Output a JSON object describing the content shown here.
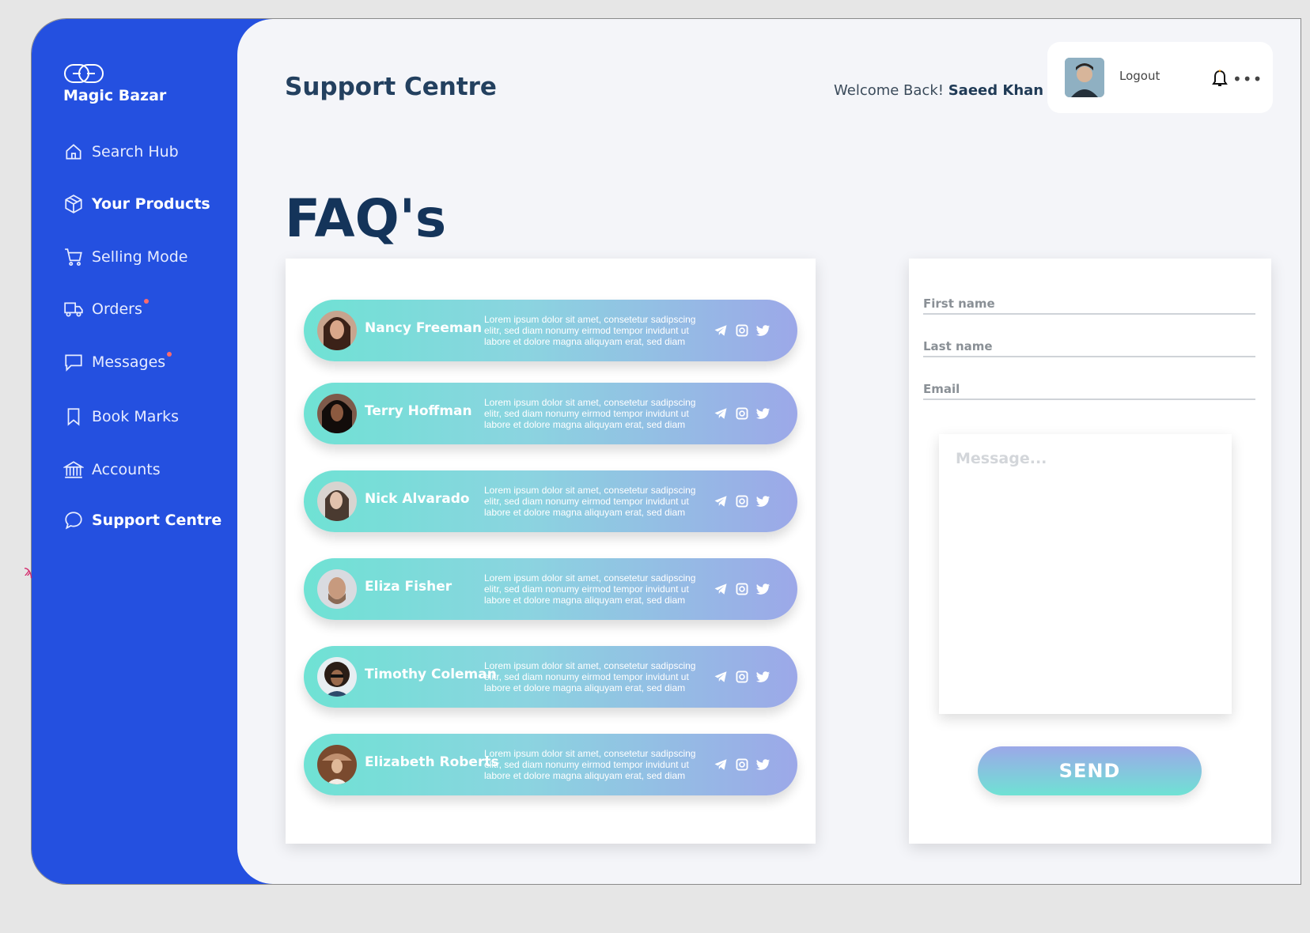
{
  "app": {
    "brand": "Magic Bazar",
    "page_title": "Support Centre",
    "welcome_prefix": "Welcome Back!",
    "user_name": "Saeed Khan",
    "logout_label": "Logout",
    "more_label": "•••"
  },
  "sidebar": {
    "items": [
      {
        "label": "Search Hub",
        "icon": "home-icon",
        "bold": false
      },
      {
        "label": "Your Products",
        "icon": "box-icon",
        "bold": true
      },
      {
        "label": "Selling Mode",
        "icon": "cart-icon",
        "bold": false
      },
      {
        "label": "Orders",
        "icon": "truck-icon",
        "bold": false,
        "badge": true
      },
      {
        "label": "Messages",
        "icon": "chat-icon",
        "bold": false,
        "badge": true
      },
      {
        "label": "Book Marks",
        "icon": "bookmark-icon",
        "bold": false
      },
      {
        "label": "Accounts",
        "icon": "bank-icon",
        "bold": false
      },
      {
        "label": "Support Centre",
        "icon": "speech-bubble-icon",
        "bold": true
      }
    ]
  },
  "faq": {
    "heading": "FAQ's",
    "entries": [
      {
        "name": "Nancy Freeman",
        "text": "Lorem ipsum dolor sit amet, consetetur sadipscing elitr, sed diam nonumy eirmod tempor invidunt ut labore et dolore magna aliquyam erat, sed diam"
      },
      {
        "name": "Terry Hoffman",
        "text": "Lorem ipsum dolor sit amet, consetetur sadipscing elitr, sed diam nonumy eirmod tempor invidunt ut labore et dolore magna aliquyam erat, sed diam"
      },
      {
        "name": "Nick Alvarado",
        "text": "Lorem ipsum dolor sit amet, consetetur sadipscing elitr, sed diam nonumy eirmod tempor invidunt ut labore et dolore magna aliquyam erat, sed diam"
      },
      {
        "name": "Eliza Fisher",
        "text": "Lorem ipsum dolor sit amet, consetetur sadipscing elitr, sed diam nonumy eirmod tempor invidunt ut labore et dolore magna aliquyam erat, sed diam"
      },
      {
        "name": "Timothy Coleman",
        "text": "Lorem ipsum dolor sit amet, consetetur sadipscing elitr, sed diam nonumy eirmod tempor invidunt ut labore et dolore magna aliquyam erat, sed diam"
      },
      {
        "name": "Elizabeth Roberts",
        "text": "Lorem ipsum dolor sit amet, consetetur sadipscing elitr, sed diam nonumy eirmod tempor invidunt ut labore et dolore magna aliquyam erat, sed diam"
      }
    ]
  },
  "form": {
    "first_name_label": "First name",
    "last_name_label": "Last name",
    "email_label": "Email",
    "message_placeholder": "Message...",
    "send_label": "SEND"
  },
  "colors": {
    "sidebar": "#2450e0",
    "heading": "#14345a",
    "gradient_start": "#6fe2d4",
    "gradient_end": "#9ca8e8"
  }
}
